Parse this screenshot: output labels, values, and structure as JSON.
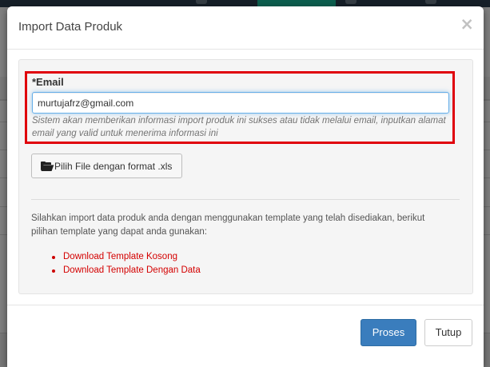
{
  "modal": {
    "title": "Import Data Produk",
    "close_symbol": "×",
    "email": {
      "label": "*Email",
      "value": "murtujafrz@gmail.com",
      "help": "Sistem akan memberikan informasi import produk ini sukses atau tidak melalui email, inputkan alamat email yang valid untuk menerima informasi ini",
      "highlight_color": "#e0000b"
    },
    "file_button": {
      "icon": "folder-open-icon",
      "label": "Pilih File dengan format .xls"
    },
    "instructions": "Silahkan import data produk anda dengan menggunakan template yang telah disediakan, berikut pilihan template yang dapat anda gunakan:",
    "templates": [
      {
        "label": "Download Template Kosong"
      },
      {
        "label": "Download Template Dengan Data"
      }
    ],
    "buttons": {
      "primary": "Proses",
      "secondary": "Tutup"
    }
  },
  "colors": {
    "primary_button": "#3a7dbd",
    "link": "#d40000",
    "nav_active": "#18bc9c",
    "nav_bar": "#2c3e50"
  }
}
